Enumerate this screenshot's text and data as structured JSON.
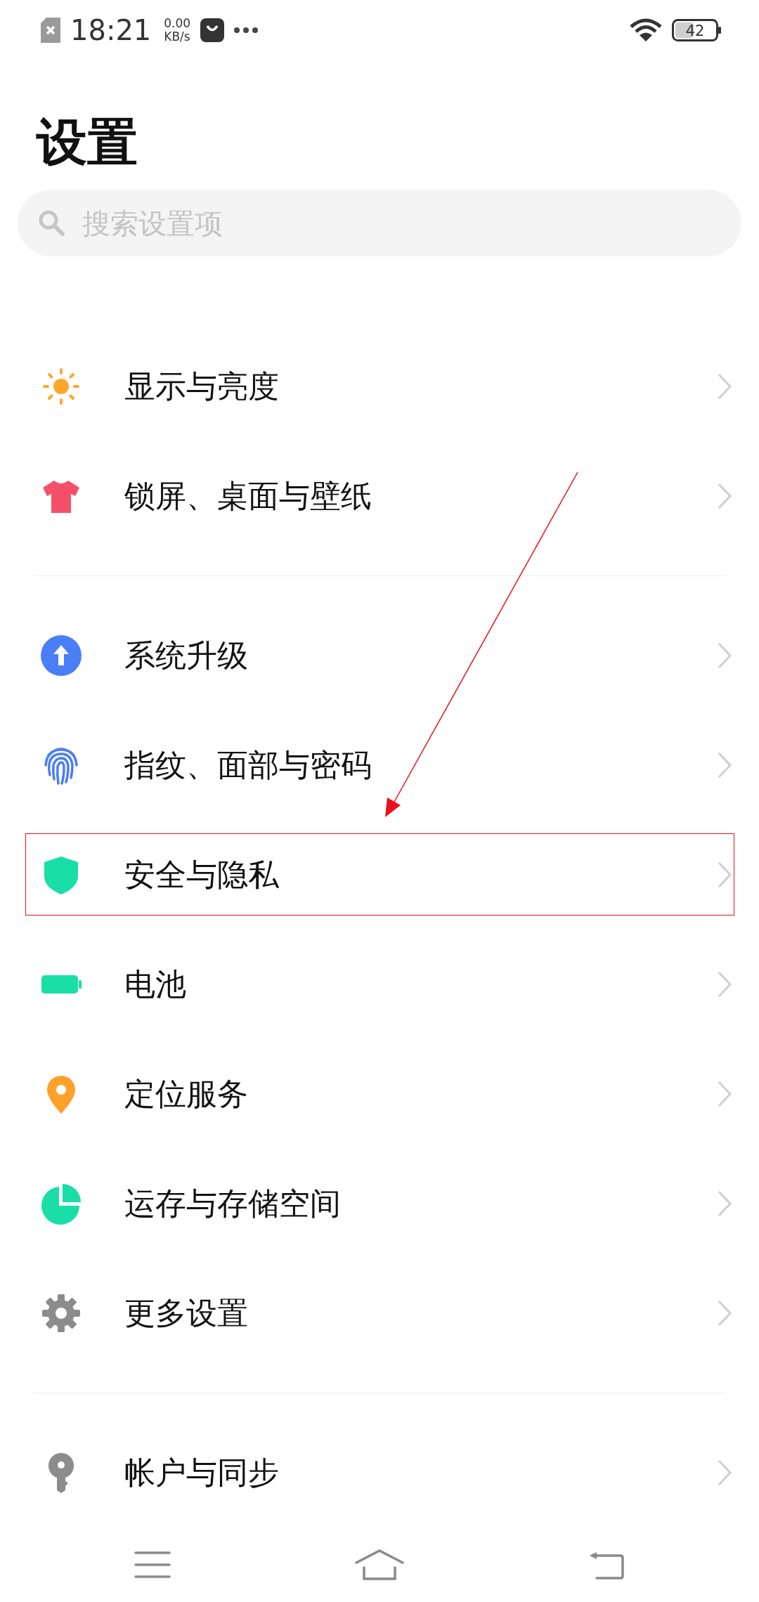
{
  "status_bar": {
    "time": "18:21",
    "speed_value": "0.00",
    "speed_unit": "KB/s",
    "battery": "42"
  },
  "title": "设置",
  "search": {
    "placeholder": "搜索设置项"
  },
  "groups": [
    {
      "items": [
        {
          "label": "显示与亮度",
          "kind": "sun",
          "color": "#ffa62b",
          "highlighted": false
        },
        {
          "label": "锁屏、桌面与壁纸",
          "kind": "shirt",
          "color": "#f5506a",
          "highlighted": false
        }
      ]
    },
    {
      "items": [
        {
          "label": "系统升级",
          "kind": "upgrade",
          "color": "#4a7ef7",
          "highlighted": false
        },
        {
          "label": "指纹、面部与密码",
          "kind": "fingerprint",
          "color": "#4a7ef7",
          "highlighted": false
        },
        {
          "label": "安全与隐私",
          "kind": "shield",
          "color": "#1adea8",
          "highlighted": true
        },
        {
          "label": "电池",
          "kind": "battery",
          "color": "#1adea8",
          "highlighted": false
        },
        {
          "label": "定位服务",
          "kind": "pin",
          "color": "#ffa02b",
          "highlighted": false
        },
        {
          "label": "运存与存储空间",
          "kind": "pie",
          "color": "#1adea8",
          "highlighted": false
        },
        {
          "label": "更多设置",
          "kind": "gear",
          "color": "#8c8c8c",
          "highlighted": false
        }
      ]
    },
    {
      "items": [
        {
          "label": "帐户与同步",
          "kind": "key",
          "color": "#8c8c8c",
          "highlighted": false
        }
      ]
    }
  ],
  "annotation": {
    "arrow": true
  }
}
